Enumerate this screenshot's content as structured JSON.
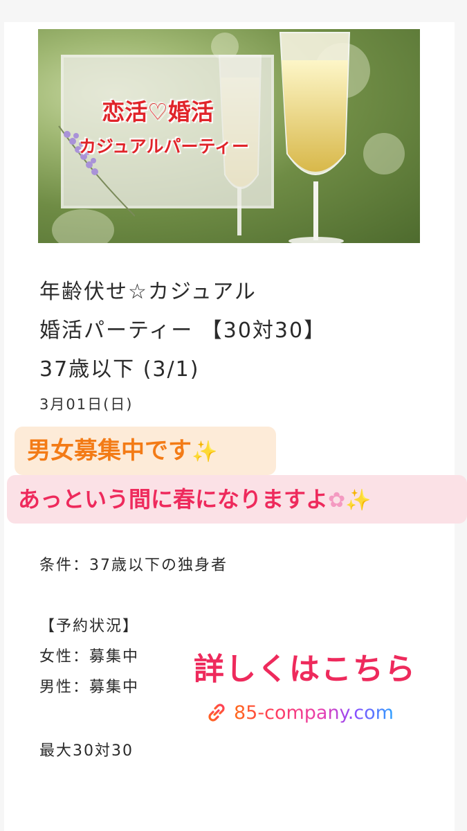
{
  "banner": {
    "line1": "恋活♡婚活",
    "line2": "カジュアルパーティー"
  },
  "event": {
    "title_line1": "年齢伏せ☆カジュアル",
    "title_line2": "婚活パーティー 【30対30】",
    "title_line3": "37歳以下 (3/1)",
    "date": "3月01日(日)"
  },
  "stickers": {
    "recruiting": "男女募集中です",
    "spring": "あっという間に春になりますよ"
  },
  "details": {
    "condition": "条件：37歳以下の独身者",
    "status_heading": "【予約状況】",
    "female": "女性：募集中",
    "male": "男性：募集中",
    "capacity": "最大30対30"
  },
  "cta": {
    "label": "詳しくはこちら",
    "link": "85-company.com"
  },
  "colors": {
    "accent_pink": "#ee2a5c",
    "accent_orange": "#f37b16",
    "banner_red": "#e0242a"
  },
  "icons": [
    "sparkles-icon",
    "cherry-blossom-icon",
    "link-icon"
  ]
}
